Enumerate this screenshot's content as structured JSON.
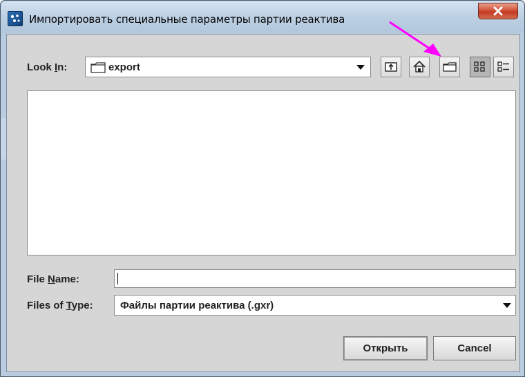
{
  "window": {
    "title": "Импортировать специальные параметры партии реактива",
    "close_glyph": "X"
  },
  "lookin": {
    "label_prefix": "Look ",
    "label_mnemonic": "I",
    "label_suffix": "n:",
    "value": "export"
  },
  "toolbar": {
    "buttons": [
      {
        "name": "up-one-level-button",
        "icon": "up-folder-icon"
      },
      {
        "name": "home-button",
        "icon": "home-icon"
      },
      {
        "name": "new-folder-button",
        "icon": "new-folder-icon"
      },
      {
        "name": "list-view-button",
        "icon": "list-view-icon",
        "active": true
      },
      {
        "name": "details-view-button",
        "icon": "details-view-icon"
      }
    ]
  },
  "filename": {
    "label_prefix": "File ",
    "label_mnemonic": "N",
    "label_suffix": "ame:",
    "value": ""
  },
  "filetype": {
    "label_prefix": "Files of ",
    "label_mnemonic": "T",
    "label_suffix": "ype:",
    "value": "Файлы партии реактива (.gxr)"
  },
  "buttons": {
    "open_label": "Открыть",
    "cancel_label": "Cancel"
  },
  "colors": {
    "annotation_arrow": "#ff00ff",
    "dialog_background": "#d6d6d6"
  }
}
